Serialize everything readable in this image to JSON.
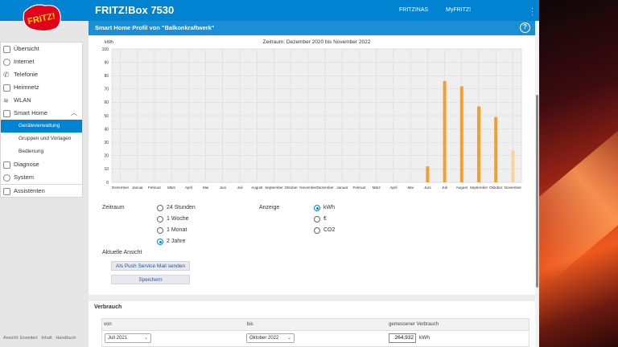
{
  "header": {
    "product": "FRITZ!Box 7530",
    "links": [
      "FRITZ!NAS",
      "MyFRITZ!"
    ],
    "logo_text": "FRITZ!"
  },
  "sidebar": {
    "items": [
      {
        "label": "Übersicht",
        "icon": "home-icon"
      },
      {
        "label": "Internet",
        "icon": "globe-icon"
      },
      {
        "label": "Telefonie",
        "icon": "phone-icon"
      },
      {
        "label": "Heimnetz",
        "icon": "network-icon"
      },
      {
        "label": "WLAN",
        "icon": "wifi-icon"
      },
      {
        "label": "Smart Home",
        "icon": "smarthome-icon"
      },
      {
        "label": "Geräteverwaltung"
      },
      {
        "label": "Gruppen und Vorlagen"
      },
      {
        "label": "Bedienung"
      },
      {
        "label": "Diagnose",
        "icon": "diagnose-icon"
      },
      {
        "label": "System",
        "icon": "system-icon"
      },
      {
        "label": "Assistenten",
        "icon": "assistant-icon"
      }
    ],
    "footer": [
      "Ansicht: Erweitert",
      "Inhalt",
      "Handbuch"
    ]
  },
  "page": {
    "title": "Smart Home Profil von \"Balkonkraftwerk\""
  },
  "chart_data": {
    "type": "bar",
    "title": "Zeitraum: Dezember 2020 bis November 2022",
    "ylabel": "kWh",
    "xlabel": "",
    "ylim": [
      0,
      100
    ],
    "yticks": [
      0,
      10,
      20,
      30,
      40,
      50,
      60,
      70,
      80,
      90,
      100
    ],
    "categories": [
      "Dezember",
      "Januar",
      "Februar",
      "März",
      "April",
      "Mai",
      "Juni",
      "Juli",
      "August",
      "September",
      "Oktober",
      "November",
      "Dezember",
      "Januar",
      "Februar",
      "März",
      "April",
      "Mai",
      "Juni",
      "Juli",
      "August",
      "September",
      "Oktober",
      "November"
    ],
    "values": [
      0,
      0,
      0,
      0,
      0,
      0,
      0,
      0,
      0,
      0,
      0,
      0,
      0,
      0,
      0,
      0,
      0,
      0,
      12,
      76,
      72,
      57,
      49,
      24
    ],
    "bar_color": "#f0a030",
    "partial_bar_color": "#f6d3a4",
    "grid": true
  },
  "controls": {
    "zeitraum_label": "Zeitraum",
    "zeitraum_options": [
      "24 Stunden",
      "1 Woche",
      "1 Monat",
      "2 Jahre"
    ],
    "zeitraum_selected": "2 Jahre",
    "anzeige_label": "Anzeige",
    "anzeige_options": [
      "kWh",
      "€",
      "CO2"
    ],
    "anzeige_selected": "kWh",
    "current_view_label": "Aktuelle Ansicht",
    "push_button": "Als Push Service Mail senden",
    "save_button": "Speichern"
  },
  "verbrauch": {
    "title": "Verbrauch",
    "col_von": "von",
    "col_bis": "bis",
    "col_measured": "gemessener Verbrauch",
    "von_value": "Juli 2021",
    "bis_value": "Oktober 2022",
    "measured_value": "264,932",
    "unit": "kWh"
  },
  "colors": {
    "header_blue": "#0084d2",
    "accent": "#0084d2"
  }
}
